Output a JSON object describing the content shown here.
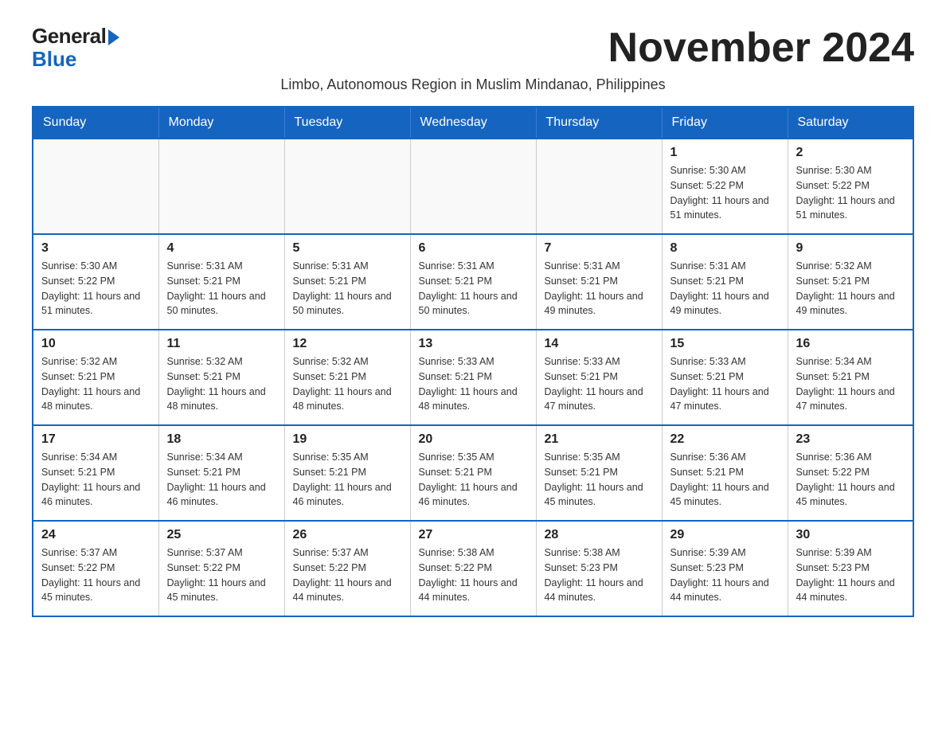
{
  "logo": {
    "general": "General",
    "blue": "Blue"
  },
  "title": "November 2024",
  "subtitle": "Limbo, Autonomous Region in Muslim Mindanao, Philippines",
  "days_of_week": [
    "Sunday",
    "Monday",
    "Tuesday",
    "Wednesday",
    "Thursday",
    "Friday",
    "Saturday"
  ],
  "weeks": [
    [
      {
        "day": "",
        "info": ""
      },
      {
        "day": "",
        "info": ""
      },
      {
        "day": "",
        "info": ""
      },
      {
        "day": "",
        "info": ""
      },
      {
        "day": "",
        "info": ""
      },
      {
        "day": "1",
        "info": "Sunrise: 5:30 AM\nSunset: 5:22 PM\nDaylight: 11 hours and 51 minutes."
      },
      {
        "day": "2",
        "info": "Sunrise: 5:30 AM\nSunset: 5:22 PM\nDaylight: 11 hours and 51 minutes."
      }
    ],
    [
      {
        "day": "3",
        "info": "Sunrise: 5:30 AM\nSunset: 5:22 PM\nDaylight: 11 hours and 51 minutes."
      },
      {
        "day": "4",
        "info": "Sunrise: 5:31 AM\nSunset: 5:21 PM\nDaylight: 11 hours and 50 minutes."
      },
      {
        "day": "5",
        "info": "Sunrise: 5:31 AM\nSunset: 5:21 PM\nDaylight: 11 hours and 50 minutes."
      },
      {
        "day": "6",
        "info": "Sunrise: 5:31 AM\nSunset: 5:21 PM\nDaylight: 11 hours and 50 minutes."
      },
      {
        "day": "7",
        "info": "Sunrise: 5:31 AM\nSunset: 5:21 PM\nDaylight: 11 hours and 49 minutes."
      },
      {
        "day": "8",
        "info": "Sunrise: 5:31 AM\nSunset: 5:21 PM\nDaylight: 11 hours and 49 minutes."
      },
      {
        "day": "9",
        "info": "Sunrise: 5:32 AM\nSunset: 5:21 PM\nDaylight: 11 hours and 49 minutes."
      }
    ],
    [
      {
        "day": "10",
        "info": "Sunrise: 5:32 AM\nSunset: 5:21 PM\nDaylight: 11 hours and 48 minutes."
      },
      {
        "day": "11",
        "info": "Sunrise: 5:32 AM\nSunset: 5:21 PM\nDaylight: 11 hours and 48 minutes."
      },
      {
        "day": "12",
        "info": "Sunrise: 5:32 AM\nSunset: 5:21 PM\nDaylight: 11 hours and 48 minutes."
      },
      {
        "day": "13",
        "info": "Sunrise: 5:33 AM\nSunset: 5:21 PM\nDaylight: 11 hours and 48 minutes."
      },
      {
        "day": "14",
        "info": "Sunrise: 5:33 AM\nSunset: 5:21 PM\nDaylight: 11 hours and 47 minutes."
      },
      {
        "day": "15",
        "info": "Sunrise: 5:33 AM\nSunset: 5:21 PM\nDaylight: 11 hours and 47 minutes."
      },
      {
        "day": "16",
        "info": "Sunrise: 5:34 AM\nSunset: 5:21 PM\nDaylight: 11 hours and 47 minutes."
      }
    ],
    [
      {
        "day": "17",
        "info": "Sunrise: 5:34 AM\nSunset: 5:21 PM\nDaylight: 11 hours and 46 minutes."
      },
      {
        "day": "18",
        "info": "Sunrise: 5:34 AM\nSunset: 5:21 PM\nDaylight: 11 hours and 46 minutes."
      },
      {
        "day": "19",
        "info": "Sunrise: 5:35 AM\nSunset: 5:21 PM\nDaylight: 11 hours and 46 minutes."
      },
      {
        "day": "20",
        "info": "Sunrise: 5:35 AM\nSunset: 5:21 PM\nDaylight: 11 hours and 46 minutes."
      },
      {
        "day": "21",
        "info": "Sunrise: 5:35 AM\nSunset: 5:21 PM\nDaylight: 11 hours and 45 minutes."
      },
      {
        "day": "22",
        "info": "Sunrise: 5:36 AM\nSunset: 5:21 PM\nDaylight: 11 hours and 45 minutes."
      },
      {
        "day": "23",
        "info": "Sunrise: 5:36 AM\nSunset: 5:22 PM\nDaylight: 11 hours and 45 minutes."
      }
    ],
    [
      {
        "day": "24",
        "info": "Sunrise: 5:37 AM\nSunset: 5:22 PM\nDaylight: 11 hours and 45 minutes."
      },
      {
        "day": "25",
        "info": "Sunrise: 5:37 AM\nSunset: 5:22 PM\nDaylight: 11 hours and 45 minutes."
      },
      {
        "day": "26",
        "info": "Sunrise: 5:37 AM\nSunset: 5:22 PM\nDaylight: 11 hours and 44 minutes."
      },
      {
        "day": "27",
        "info": "Sunrise: 5:38 AM\nSunset: 5:22 PM\nDaylight: 11 hours and 44 minutes."
      },
      {
        "day": "28",
        "info": "Sunrise: 5:38 AM\nSunset: 5:23 PM\nDaylight: 11 hours and 44 minutes."
      },
      {
        "day": "29",
        "info": "Sunrise: 5:39 AM\nSunset: 5:23 PM\nDaylight: 11 hours and 44 minutes."
      },
      {
        "day": "30",
        "info": "Sunrise: 5:39 AM\nSunset: 5:23 PM\nDaylight: 11 hours and 44 minutes."
      }
    ]
  ]
}
